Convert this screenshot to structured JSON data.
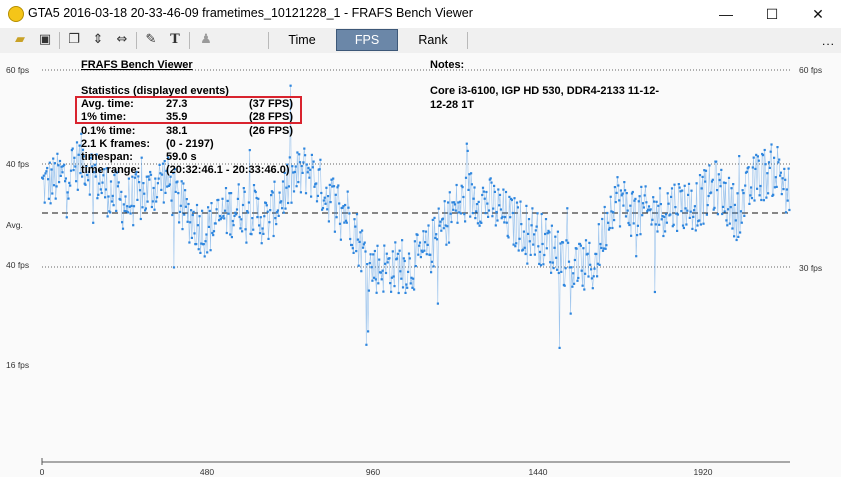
{
  "window": {
    "title": "GTA5 2016-03-18 20-33-46-09 frametimes_10121228_1 - FRAFS Bench Viewer",
    "minimize_glyph": "—",
    "maximize_glyph": "☐",
    "close_glyph": "✕"
  },
  "toolbar": {
    "icons": [
      "open-folder-icon",
      "save-icon",
      "copy-icon",
      "fit-vertical-icon",
      "fit-horizontal-icon",
      "wrench-icon",
      "text-icon",
      "user-icon"
    ],
    "tabs": [
      {
        "label": "Time",
        "active": false
      },
      {
        "label": "FPS",
        "active": true
      },
      {
        "label": "Rank",
        "active": false
      }
    ],
    "more_label": "..."
  },
  "chart": {
    "header": "FRAFS Bench Viewer",
    "notes_label": "Notes:",
    "notes_text_line1": "Core i3-6100, IGP HD 530, DDR4-2133 11-12-",
    "notes_text_line2": "12-28 1T",
    "stats_title": "Statistics (displayed events)",
    "stats": [
      {
        "label": "Avg. time:",
        "value": "27.3",
        "extra": "(37 FPS)"
      },
      {
        "label": "1% time:",
        "value": "35.9",
        "extra": "(28 FPS)"
      },
      {
        "label": "0.1% time:",
        "value": "38.1",
        "extra": "(26 FPS)"
      },
      {
        "label": "2.1 K frames:",
        "value": "(0 - 2197)",
        "extra": ""
      },
      {
        "label": "timespan:",
        "value": "59.0 s",
        "extra": ""
      },
      {
        "label": "time range:",
        "value": "(20:32:46.1 - 20:33:46.0)",
        "extra": ""
      }
    ],
    "highlight_color": "#d9232e",
    "series_color": "#2e86de"
  },
  "chart_data": {
    "type": "scatter",
    "title": "",
    "xlabel": "",
    "ylabel": "",
    "x_ticks": [
      "0",
      "480",
      "960",
      "1440",
      "1920"
    ],
    "xlim": [
      0,
      2197
    ],
    "left_axis_labels": [
      "60 fps",
      "40 fps",
      "Avg.",
      "40 fps",
      "16 fps"
    ],
    "right_axis_labels": [
      "60 fps",
      "30 fps"
    ],
    "avg_fps": 37,
    "series": [
      {
        "x": [
          0,
          60,
          120,
          180,
          240,
          300,
          360,
          420,
          480,
          540,
          600,
          660,
          720,
          780,
          840,
          900,
          960,
          1020,
          1080,
          1140,
          1200,
          1260,
          1320,
          1380,
          1440,
          1500,
          1560,
          1620,
          1680,
          1740,
          1800,
          1860,
          1920,
          1980,
          2040,
          2100,
          2160,
          2197
        ],
        "fps": [
          40,
          41,
          43,
          40,
          38,
          39,
          41,
          37,
          35,
          37,
          38,
          36,
          40,
          42,
          39,
          37,
          31,
          31,
          31,
          33,
          37,
          39,
          38,
          36,
          35,
          33,
          31,
          31,
          39,
          37,
          37,
          38,
          38,
          40,
          37,
          41,
          42,
          39
        ]
      }
    ]
  }
}
